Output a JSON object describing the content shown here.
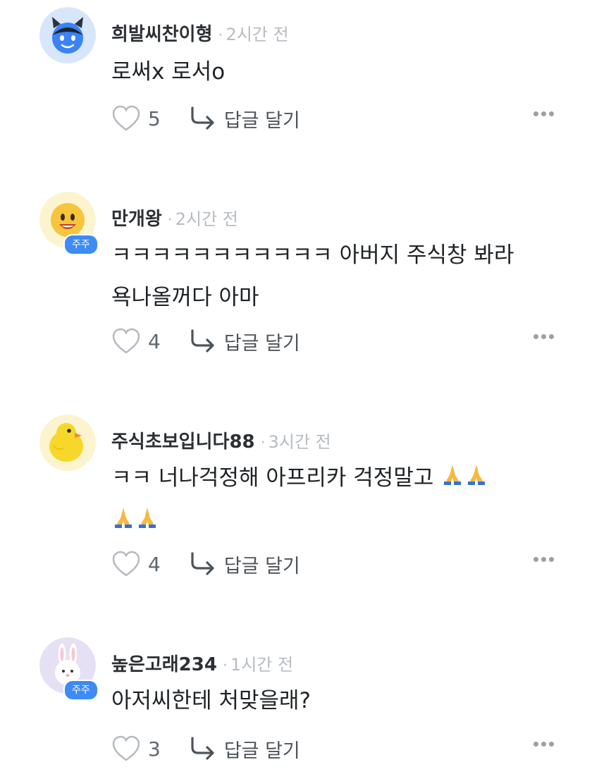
{
  "comments": [
    {
      "username": "희발씨찬이형",
      "sep": "·",
      "time": "2시간 전",
      "body_lines": [
        "로써x 로서o"
      ],
      "likes": "5",
      "reply_label": "답글 달기",
      "badge": "",
      "avatar_icon": "devil-emoji-avatar"
    },
    {
      "username": "만개왕",
      "sep": "·",
      "time": "2시간 전",
      "body_lines": [
        "ㅋㅋㅋㅋㅋㅋㅋㅋㅋㅋㅋ 아버지 주식창 봐라",
        "욕나올꺼다 아마"
      ],
      "likes": "4",
      "reply_label": "답글 달기",
      "badge": "주주",
      "avatar_icon": "smiley-emoji-avatar"
    },
    {
      "username": "주식초보입니다88",
      "sep": "·",
      "time": "3시간 전",
      "body_lines": [
        "ㅋㅋ 너나걱정해 아프리카 걱정말고",
        ""
      ],
      "likes": "4",
      "reply_label": "답글 달기",
      "badge": "",
      "avatar_icon": "chick-avatar"
    },
    {
      "username": "높은고래234",
      "sep": "·",
      "time": "1시간 전",
      "body_lines": [
        "아저씨한테 처맞을래?"
      ],
      "likes": "3",
      "reply_label": "답글 달기",
      "badge": "주주",
      "avatar_icon": "bunny-avatar"
    }
  ],
  "colors": {
    "accent": "#3d8bf5",
    "muted": "#b7bcc2"
  }
}
